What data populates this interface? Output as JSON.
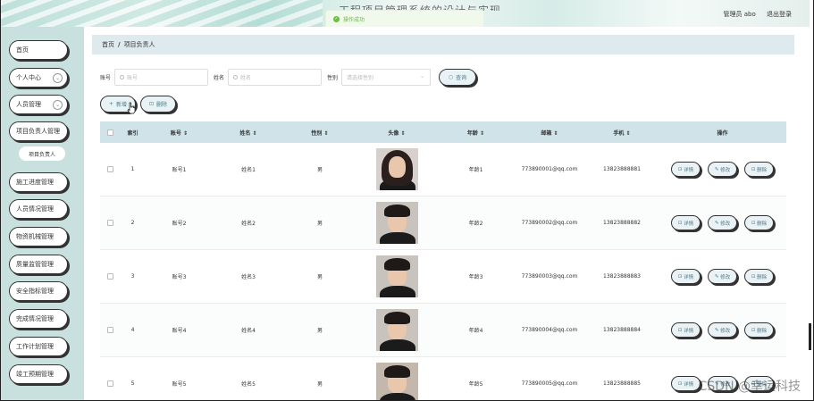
{
  "header": {
    "site_title": "工程项目管理系统的设计与实现",
    "toast": "操作成功",
    "user_label": "管理员 abo",
    "logout": "退出登录"
  },
  "sidebar": {
    "items": [
      {
        "label": "首页"
      },
      {
        "label": "个人中心"
      },
      {
        "label": "人员管理"
      },
      {
        "label": "项目负责人管理"
      },
      {
        "label": "项目负责人"
      },
      {
        "label": "施工进度管理"
      },
      {
        "label": "人员情况管理"
      },
      {
        "label": "物资机械管理"
      },
      {
        "label": "质量监管管理"
      },
      {
        "label": "安全指标管理"
      },
      {
        "label": "完成情况管理"
      },
      {
        "label": "工作计划管理"
      },
      {
        "label": "竣工预期管理"
      }
    ]
  },
  "breadcrumb": {
    "home": "首页",
    "sep": "/",
    "current": "项目负责人"
  },
  "search": {
    "account_label": "账号",
    "account_placeholder": "账号",
    "name_label": "姓名",
    "name_placeholder": "姓名",
    "gender_label": "性别",
    "gender_placeholder": "请选择性别",
    "query_button": "查询"
  },
  "actions": {
    "add": "新增",
    "delete": "删除"
  },
  "table": {
    "columns": [
      "索引",
      "账号",
      "姓名",
      "性别",
      "头像",
      "年龄",
      "邮箱",
      "手机",
      "操作"
    ],
    "rows": [
      {
        "index": "1",
        "account": "账号1",
        "name": "姓名1",
        "gender": "男",
        "age": "年龄1",
        "email": "773890001@qq.com",
        "phone": "13823888881"
      },
      {
        "index": "2",
        "account": "账号2",
        "name": "姓名2",
        "gender": "男",
        "age": "年龄2",
        "email": "773890002@qq.com",
        "phone": "13823888882"
      },
      {
        "index": "3",
        "account": "账号3",
        "name": "姓名3",
        "gender": "男",
        "age": "年龄3",
        "email": "773890003@qq.com",
        "phone": "13823888883"
      },
      {
        "index": "4",
        "account": "账号4",
        "name": "姓名4",
        "gender": "男",
        "age": "年龄4",
        "email": "773890004@qq.com",
        "phone": "13823888884"
      },
      {
        "index": "5",
        "account": "账号5",
        "name": "姓名5",
        "gender": "男",
        "age": "年龄5",
        "email": "773890005@qq.com",
        "phone": "13823888885"
      }
    ],
    "op_detail": "详情",
    "op_edit": "修改",
    "op_delete": "删除"
  },
  "watermark": "CSDN @幸运科技",
  "colors": {
    "sidebar_bg": "#c9e1de",
    "table_header_bg": "#cfe3e8",
    "breadcrumb_bg": "#dfeaef",
    "toast_green": "#67c23a",
    "button_text": "#4a7c8c"
  }
}
